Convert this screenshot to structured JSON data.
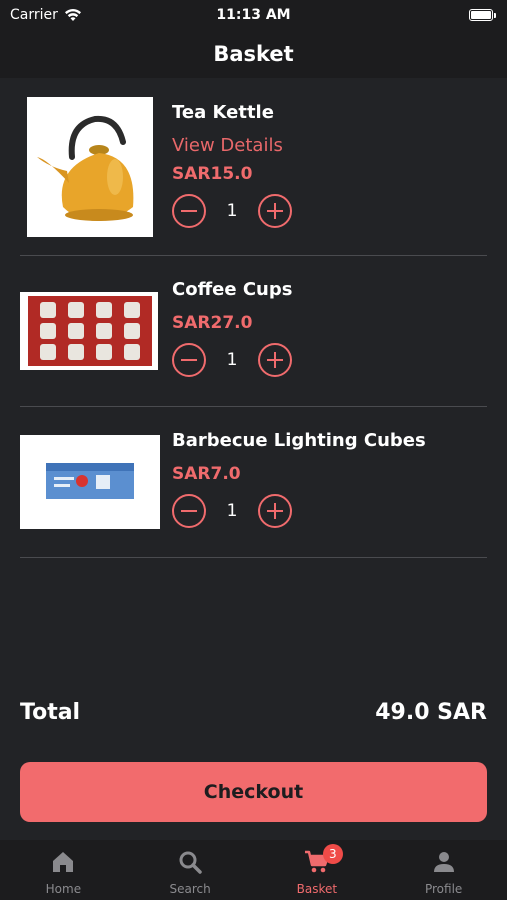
{
  "status_bar": {
    "carrier": "Carrier",
    "time": "11:13 AM"
  },
  "header": {
    "title": "Basket"
  },
  "items": [
    {
      "name": "Tea Kettle",
      "link": "View Details",
      "price": "SAR15.0",
      "quantity": "1",
      "image_icon": "tea-kettle-photo"
    },
    {
      "name": "Coffee Cups",
      "price": "SAR27.0",
      "quantity": "1",
      "image_icon": "coffee-cups-photo"
    },
    {
      "name": "Barbecue Lighting Cubes",
      "price": "SAR7.0",
      "quantity": "1",
      "image_icon": "lighting-cubes-photo"
    }
  ],
  "total": {
    "label": "Total",
    "value": "49.0 SAR"
  },
  "checkout": {
    "label": "Checkout"
  },
  "tabs": [
    {
      "label": "Home",
      "icon": "home-icon"
    },
    {
      "label": "Search",
      "icon": "search-icon"
    },
    {
      "label": "Basket",
      "icon": "cart-icon",
      "badge": "3",
      "active": true
    },
    {
      "label": "Profile",
      "icon": "person-icon"
    }
  ],
  "colors": {
    "accent": "#f06b6d",
    "background": "#222326",
    "bar_background": "#1c1c1e",
    "badge": "#ef4b48"
  }
}
